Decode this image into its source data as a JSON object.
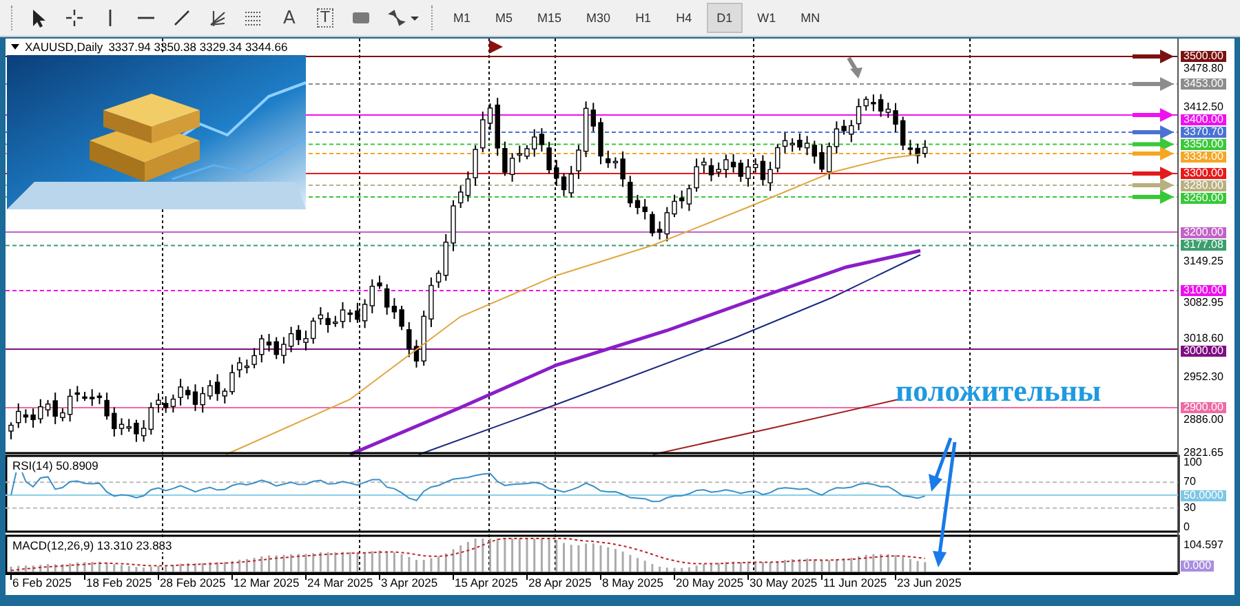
{
  "toolbar": {
    "tools": [
      {
        "kind": "cursor"
      },
      {
        "kind": "crosshair"
      },
      {
        "kind": "vline"
      },
      {
        "kind": "hline"
      },
      {
        "kind": "trendline"
      },
      {
        "kind": "fan"
      },
      {
        "kind": "grid"
      },
      {
        "kind": "text",
        "glyph": "A"
      },
      {
        "kind": "label",
        "glyph": "T"
      },
      {
        "kind": "rectangle"
      },
      {
        "kind": "arrows"
      }
    ],
    "timeframes": [
      {
        "label": "M1",
        "selected": false
      },
      {
        "label": "M5",
        "selected": false
      },
      {
        "label": "M15",
        "selected": false
      },
      {
        "label": "M30",
        "selected": false
      },
      {
        "label": "H1",
        "selected": false
      },
      {
        "label": "H4",
        "selected": false
      },
      {
        "label": "D1",
        "selected": true
      },
      {
        "label": "W1",
        "selected": false
      },
      {
        "label": "MN",
        "selected": false
      }
    ]
  },
  "chart": {
    "symbol": "XAUUSD,Daily",
    "quotes": "3337.94 3350.38 3329.34 3344.66",
    "picture": {
      "kind": "picture"
    },
    "price_ticks": [
      "3478.80",
      "3412.50",
      "3149.25",
      "3082.95",
      "3018.60",
      "2952.30",
      "2886.00",
      "2821.65"
    ],
    "levels": [
      {
        "price": "3500.00",
        "color": "#7b1111",
        "kind": "solid",
        "arrow": true
      },
      {
        "price": "3453.00",
        "color": "#8c8c8c",
        "kind": "dashed",
        "arrow": true
      },
      {
        "price": "3400.00",
        "color": "#f010f0",
        "kind": "solid",
        "arrow": true
      },
      {
        "price": "3370.70",
        "color": "#4a72d4",
        "kind": "dashed",
        "arrow": true
      },
      {
        "price": "3350.00",
        "color": "#3bc83b",
        "kind": "dashed",
        "arrow": true
      },
      {
        "price": "3334.00",
        "color": "#f5a623",
        "kind": "dashed",
        "arrow": true
      },
      {
        "price": "3300.00",
        "color": "#e41b1b",
        "kind": "solid",
        "arrow": true
      },
      {
        "price": "3280.00",
        "color": "#b8b07e",
        "kind": "dashed",
        "arrow": true
      },
      {
        "price": "3260.00",
        "color": "#36c936",
        "kind": "dashed",
        "arrow": true
      },
      {
        "price": "3200.00",
        "color": "#c262c8",
        "kind": "solid",
        "arrow": false
      },
      {
        "price": "3177.08",
        "color": "#3b9e6e",
        "kind": "dashed",
        "arrow": false
      },
      {
        "price": "3100.00",
        "color": "#ee10ee",
        "kind": "dashed",
        "arrow": false
      },
      {
        "price": "3000.00",
        "color": "#7e0f82",
        "kind": "solid",
        "arrow": false
      },
      {
        "price": "2900.00",
        "color": "#f06aa4",
        "kind": "solid",
        "arrow": false
      }
    ],
    "annotation": "положительны"
  },
  "rsi": {
    "label": "RSI(14) 50.8909",
    "ticks": [
      "100",
      "70",
      "30",
      "0"
    ],
    "level_label": "50.0000"
  },
  "macd": {
    "label": "MACD(12,26,9) 13.310 23.883",
    "ticks": [
      "104.597"
    ],
    "level_label": "0.000"
  },
  "dates": [
    "6 Feb 2025",
    "18 Feb 2025",
    "28 Feb 2025",
    "12 Mar 2025",
    "24 Mar 2025",
    "3 Apr 2025",
    "15 Apr 2025",
    "28 Apr 2025",
    "8 May 2025",
    "20 May 2025",
    "30 May 2025",
    "11 Jun 2025",
    "23 Jun 2025"
  ]
}
